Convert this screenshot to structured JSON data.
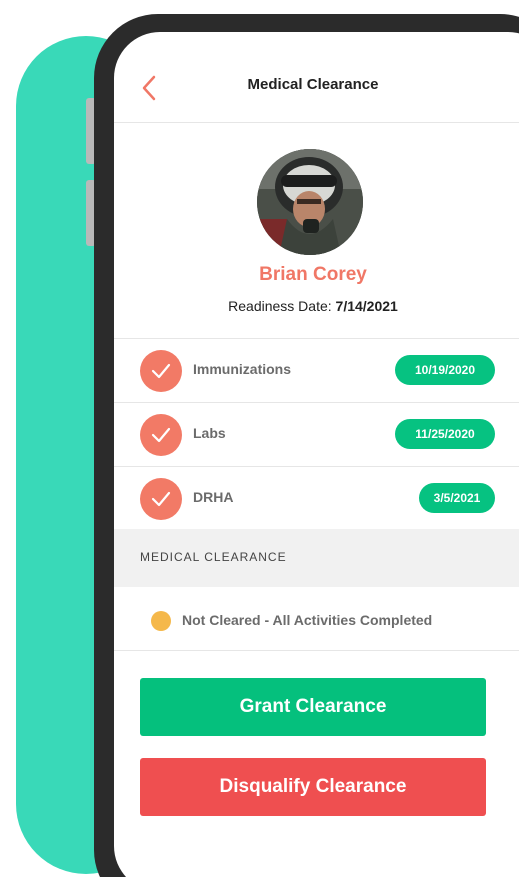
{
  "header": {
    "title": "Medical Clearance",
    "back_icon": "chevron-left-icon"
  },
  "profile": {
    "name": "Brian Corey",
    "readiness_label": "Readiness Date: ",
    "readiness_date": "7/14/2021"
  },
  "activities": [
    {
      "label": "Immunizations",
      "date": "10/19/2020",
      "icon": "check-icon"
    },
    {
      "label": "Labs",
      "date": "11/25/2020",
      "icon": "check-icon"
    },
    {
      "label": "DRHA",
      "date": "3/5/2021",
      "icon": "check-icon"
    }
  ],
  "clearance": {
    "section_label": "MEDICAL CLEARANCE",
    "status_text": "Not Cleared - All Activities Completed"
  },
  "actions": {
    "grant_label": "Grant Clearance",
    "disqualify_label": "Disqualify Clearance"
  },
  "colors": {
    "accent": "#f07766",
    "teal_backdrop": "#39d9b8",
    "success": "#05c07d",
    "danger": "#ef4f50",
    "status_pending": "#f5b84a"
  }
}
